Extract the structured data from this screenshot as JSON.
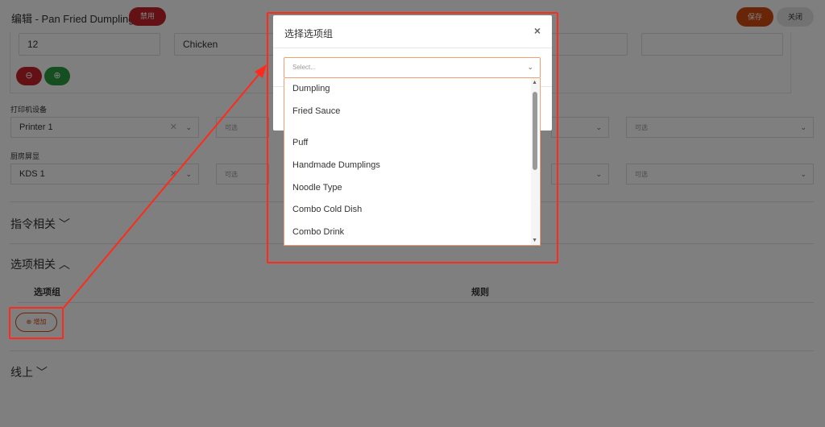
{
  "header": {
    "title": "编辑 - Pan Fried Dumpling",
    "disabled_badge": "禁用",
    "save_label": "保存",
    "close_label": "关闭"
  },
  "top_fields": {
    "value_1": "12",
    "value_2": "Chicken",
    "minus_icon": "⊖",
    "plus_icon": "⊕"
  },
  "printer": {
    "label": "打印机设备",
    "selected": "Printer 1",
    "placeholder": "可选"
  },
  "kds": {
    "label": "厨房屏显",
    "selected": "KDS 1",
    "placeholder": "可选"
  },
  "sections": {
    "commands": "指令相关",
    "options": "选项相关",
    "online": "线上"
  },
  "options_table": {
    "col_group": "选项组",
    "col_rule": "规则",
    "add_label": "增加"
  },
  "modal": {
    "title": "选择选项组",
    "placeholder": "Select...",
    "options": [
      "Dumpling",
      "Fried Sauce",
      "Puff",
      "Handmade Dumplings",
      "Noodle Type",
      "Combo Cold Dish",
      "Combo Drink"
    ]
  },
  "colors": {
    "accent": "#d14b10",
    "danger": "#c8232c",
    "success": "#2c9e3f",
    "annotation": "#ff2a1a"
  }
}
